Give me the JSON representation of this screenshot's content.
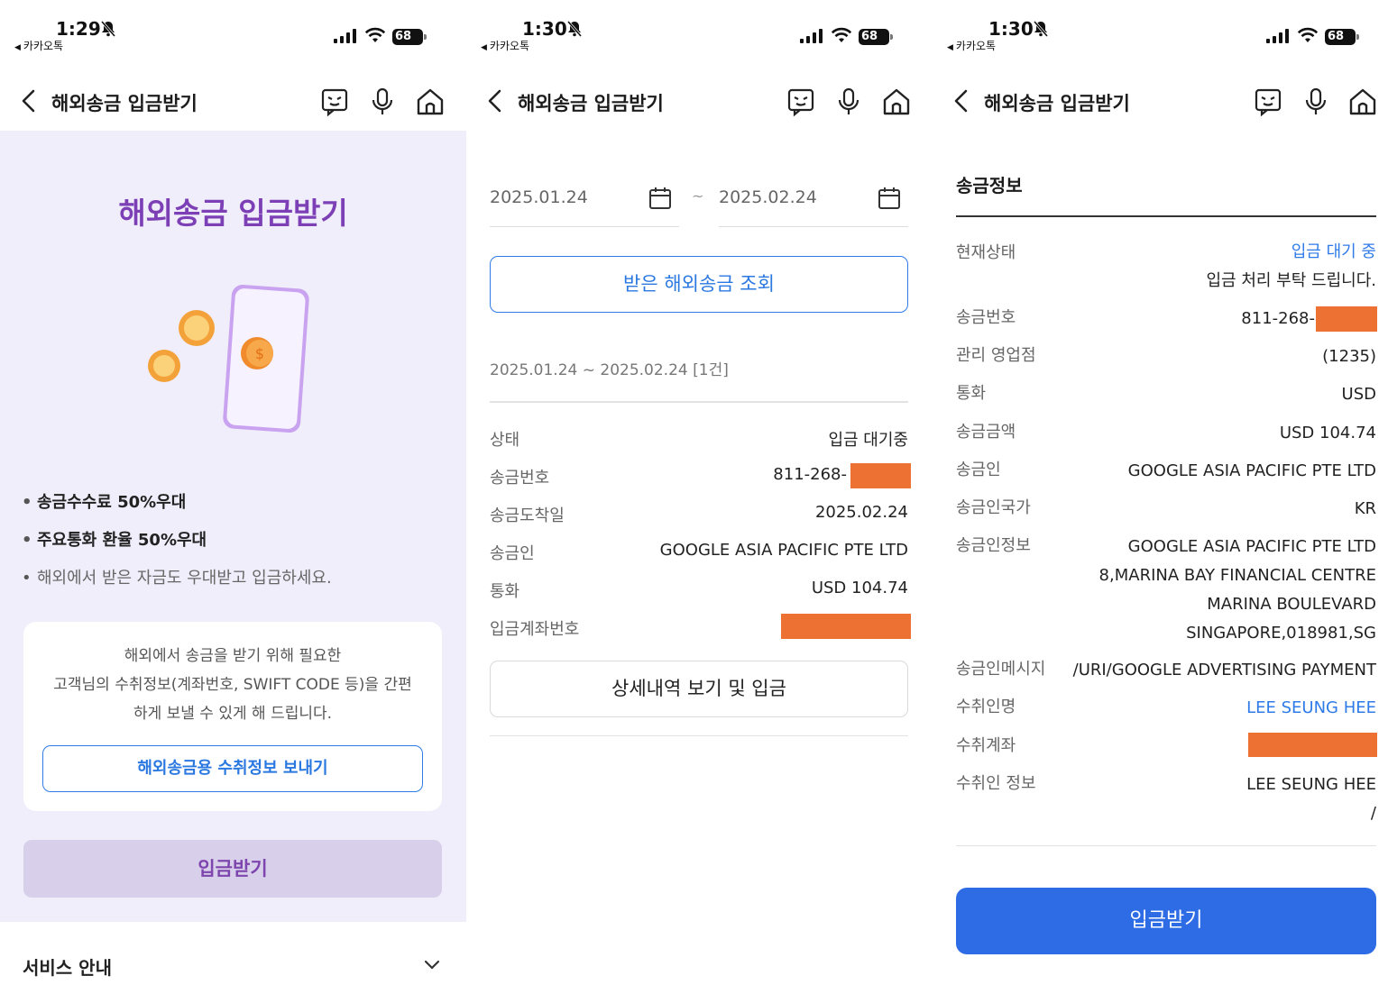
{
  "status_bars": [
    {
      "time": "1:29",
      "back_app": "카카오톡",
      "battery": "68"
    },
    {
      "time": "1:30",
      "back_app": "카카오톡",
      "battery": "68"
    },
    {
      "time": "1:30",
      "back_app": "카카오톡",
      "battery": "68"
    }
  ],
  "header": {
    "title": "해외송금 입금받기"
  },
  "screen1": {
    "hero_title": "해외송금 입금받기",
    "bullets": [
      "송금수수료 50%우대",
      "주요통화 환율 50%우대",
      "해외에서 받은 자금도 우대받고 입금하세요."
    ],
    "card_lines": [
      "해외에서 송금을 받기 위해 필요한",
      "고객님의 수취정보(계좌번호, SWIFT CODE 등)을 간편",
      "하게 보낼 수 있게 해 드립니다."
    ],
    "card_button": "해외송금용 수취정보 보내기",
    "receive_button": "입금받기",
    "service_label": "서비스 안내"
  },
  "screen2": {
    "date_from": "2025.01.24",
    "date_sep": "~",
    "date_to": "2025.02.24",
    "search_button": "받은 해외송금 조회",
    "range_summary": "2025.01.24 ~ 2025.02.24 [1건]",
    "rows": [
      {
        "key": "상태",
        "value": "입금 대기중"
      },
      {
        "key": "송금번호",
        "value": "811-268-"
      },
      {
        "key": "송금도착일",
        "value": "2025.02.24"
      },
      {
        "key": "송금인",
        "value": "GOOGLE ASIA PACIFIC PTE LTD"
      },
      {
        "key": "통화",
        "value": "USD 104.74"
      },
      {
        "key": "입금계좌번호",
        "value": ""
      }
    ],
    "detail_button": "상세내역 보기 및 입금"
  },
  "screen3": {
    "section_title": "송금정보",
    "status_key": "현재상태",
    "status_value": "입금 대기 중",
    "status_note": "입금 처리 부탁 드립니다.",
    "rows": [
      {
        "key": "송금번호",
        "lines": [
          "811-268-"
        ]
      },
      {
        "key": "관리 영업점",
        "lines": [
          "(1235)"
        ]
      },
      {
        "key": "통화",
        "lines": [
          "USD"
        ]
      },
      {
        "key": "송금금액",
        "lines": [
          "USD 104.74"
        ]
      },
      {
        "key": "송금인",
        "lines": [
          "GOOGLE ASIA PACIFIC PTE LTD"
        ]
      },
      {
        "key": "송금인국가",
        "lines": [
          "KR"
        ]
      },
      {
        "key": "송금인정보",
        "lines": [
          "GOOGLE ASIA PACIFIC PTE LTD",
          "8,MARINA BAY FINANCIAL CENTRE",
          "MARINA BOULEVARD",
          "SINGAPORE,018981,SG"
        ]
      },
      {
        "key": "송금인메시지",
        "lines": [
          "/URI/GOOGLE ADVERTISING PAYMENT"
        ]
      },
      {
        "key": "수취인명",
        "lines": [
          "LEE SEUNG HEE"
        ]
      },
      {
        "key": "수취계좌",
        "lines": [
          ""
        ]
      },
      {
        "key": "수취인 정보",
        "lines": [
          "LEE SEUNG HEE",
          "/"
        ]
      }
    ],
    "receive_button": "입금받기"
  },
  "colors": {
    "purple": "#7c3fb6",
    "blue": "#2f7be8",
    "redact": "#ec7132",
    "primary_button": "#2e6ce6"
  }
}
